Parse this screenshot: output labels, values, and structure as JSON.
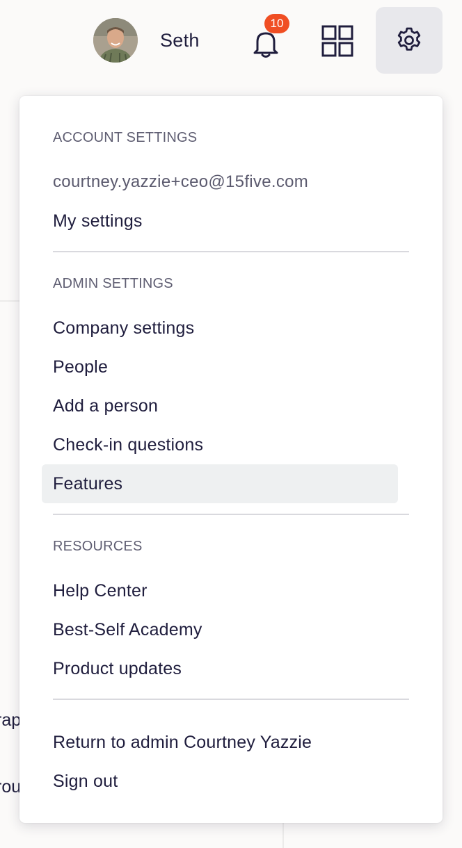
{
  "header": {
    "user_name": "Seth",
    "notification_count": "10",
    "colors": {
      "badge": "#f04e23",
      "settings_button_bg": "#e8e8ec",
      "text": "#1f1d3d"
    },
    "icons": [
      "avatar",
      "bell-icon",
      "apps-grid-icon",
      "gear-icon"
    ]
  },
  "background": {
    "fragment_1": "rap",
    "fragment_2": "rou"
  },
  "menu": {
    "account_heading": "ACCOUNT SETTINGS",
    "email": "courtney.yazzie+ceo@15five.com",
    "my_settings": "My settings",
    "admin_heading": "ADMIN SETTINGS",
    "company_settings": "Company settings",
    "people": "People",
    "add_person": "Add a person",
    "checkin_questions": "Check-in questions",
    "features": "Features",
    "resources_heading": "RESOURCES",
    "help_center": "Help Center",
    "best_self_academy": "Best-Self Academy",
    "product_updates": "Product updates",
    "return_to_admin": "Return to admin Courtney Yazzie",
    "sign_out": "Sign out",
    "highlighted_item": "Features",
    "highlight_color": "#eef0f1"
  }
}
